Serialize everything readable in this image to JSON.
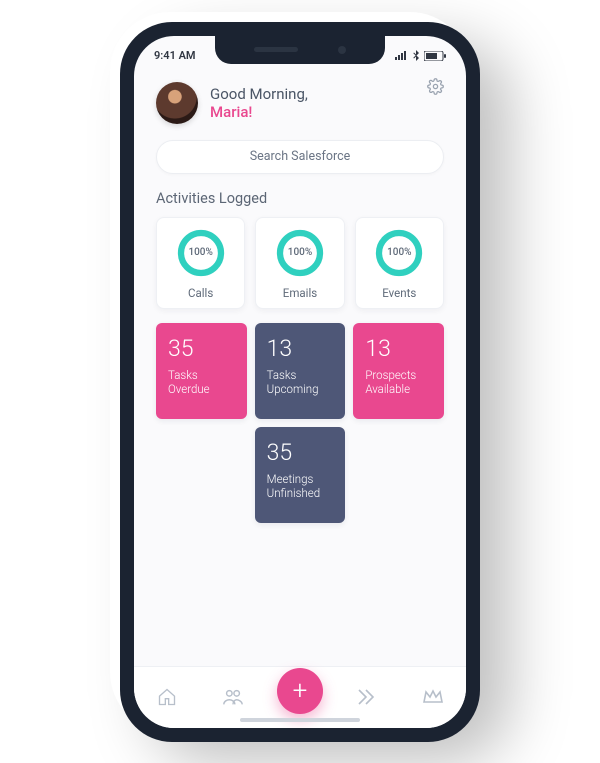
{
  "status": {
    "time": "9:41 AM"
  },
  "header": {
    "greeting": "Good Morning,",
    "user_name": "Maria!"
  },
  "search": {
    "placeholder": "Search Salesforce"
  },
  "section": {
    "title": "Activities Logged"
  },
  "rings": [
    {
      "percent": "100%",
      "label": "Calls"
    },
    {
      "percent": "100%",
      "label": "Emails"
    },
    {
      "percent": "100%",
      "label": "Events"
    }
  ],
  "tiles": [
    {
      "count": "35",
      "label": "Tasks\nOverdue",
      "color": "pink"
    },
    {
      "count": "13",
      "label": "Tasks\nUpcoming",
      "color": "navy"
    },
    {
      "count": "13",
      "label": "Prospects\nAvailable",
      "color": "pink"
    },
    {
      "count": "35",
      "label": "Meetings\nUnfinished",
      "color": "navy"
    }
  ],
  "colors": {
    "accent_pink": "#e9488f",
    "accent_navy": "#4e5777",
    "ring_teal": "#2fd0bf"
  },
  "icons": {
    "settings": "gear-icon",
    "tabs": [
      "home-icon",
      "people-icon",
      "add-icon",
      "forward-icon",
      "crown-icon"
    ]
  }
}
